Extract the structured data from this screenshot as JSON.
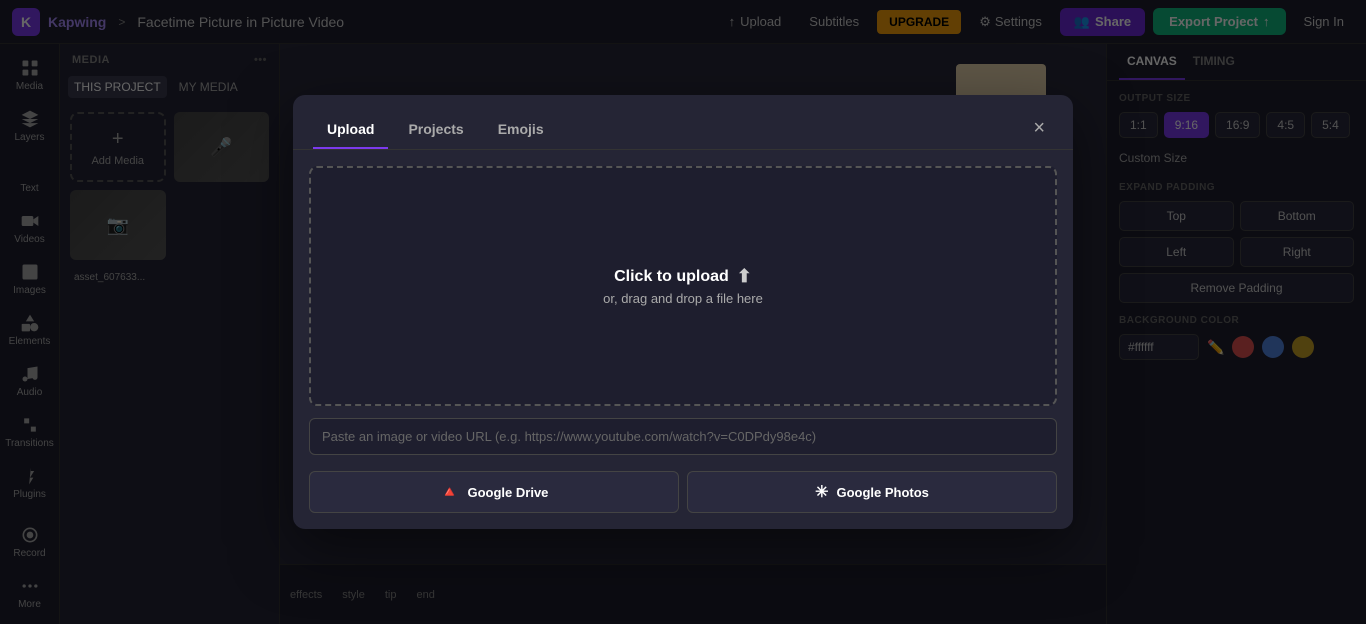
{
  "app": {
    "logo_letter": "K",
    "brand": "Kapwing",
    "breadcrumb_sep": ">",
    "project_title": "Facetime Picture in Picture Video"
  },
  "topnav": {
    "upload_label": "Upload",
    "subtitles_label": "Subtitles",
    "upgrade_label": "UPGRADE",
    "settings_label": "Settings",
    "share_label": "Share",
    "export_label": "Export Project",
    "signin_label": "Sign In"
  },
  "sidebar": {
    "items": [
      {
        "id": "media",
        "label": "Media",
        "icon": "grid"
      },
      {
        "id": "layers",
        "label": "Layers",
        "icon": "layers"
      },
      {
        "id": "text",
        "label": "Text",
        "icon": "text"
      },
      {
        "id": "videos",
        "label": "Videos",
        "icon": "video"
      },
      {
        "id": "images",
        "label": "Images",
        "icon": "image"
      },
      {
        "id": "elements",
        "label": "Elements",
        "icon": "shapes"
      },
      {
        "id": "audio",
        "label": "Audio",
        "icon": "music"
      },
      {
        "id": "transitions",
        "label": "Transitions",
        "icon": "transitions"
      },
      {
        "id": "plugins",
        "label": "Plugins",
        "icon": "plugins"
      },
      {
        "id": "record",
        "label": "Record",
        "icon": "record"
      },
      {
        "id": "more",
        "label": "More",
        "icon": "more"
      }
    ]
  },
  "media_panel": {
    "title": "MEDIA",
    "tabs": [
      {
        "id": "this_project",
        "label": "THIS PROJECT",
        "active": true
      },
      {
        "id": "my_media",
        "label": "MY MEDIA",
        "active": false
      }
    ],
    "add_media_label": "Add Media",
    "filename": "asset_607633..."
  },
  "right_panel": {
    "tabs": [
      {
        "id": "canvas",
        "label": "CANVAS",
        "active": true
      },
      {
        "id": "timing",
        "label": "TIMING",
        "active": false
      }
    ],
    "output_size_title": "OUTPUT SIZE",
    "size_options": [
      {
        "label": "1:1",
        "active": false
      },
      {
        "label": "9:16",
        "active": true
      },
      {
        "label": "16:9",
        "active": false
      },
      {
        "label": "4:5",
        "active": false
      },
      {
        "label": "5:4",
        "active": false
      }
    ],
    "custom_size_label": "Custom Size",
    "expand_padding_title": "EXPAND PADDING",
    "padding_buttons": [
      {
        "label": "Top",
        "id": "top"
      },
      {
        "label": "Bottom",
        "id": "bottom"
      },
      {
        "label": "Left",
        "id": "left"
      },
      {
        "label": "Right",
        "id": "right"
      }
    ],
    "remove_padding_label": "Remove Padding",
    "bg_color_title": "BACKGROUND COLOR",
    "color_hex": "#ffffff",
    "color_swatches": [
      {
        "color": "#e05252",
        "label": "red"
      },
      {
        "color": "#5284e0",
        "label": "blue"
      },
      {
        "color": "#e0a952",
        "label": "gold"
      }
    ]
  },
  "modal": {
    "tabs": [
      {
        "id": "upload",
        "label": "Upload",
        "active": true
      },
      {
        "id": "projects",
        "label": "Projects",
        "active": false
      },
      {
        "id": "emojis",
        "label": "Emojis",
        "active": false
      }
    ],
    "close_symbol": "×",
    "upload_zone": {
      "main_text": "Click to upload",
      "sub_text": "or, drag and drop a file here"
    },
    "url_placeholder": "Paste an image or video URL (e.g. https://www.youtube.com/watch?v=C0DPdy98e4c)",
    "gdrive_label": "Google Drive",
    "gphotos_label": "Google Photos"
  },
  "timeline": {
    "labels": [
      "effects",
      "style",
      "tip",
      "end"
    ]
  }
}
